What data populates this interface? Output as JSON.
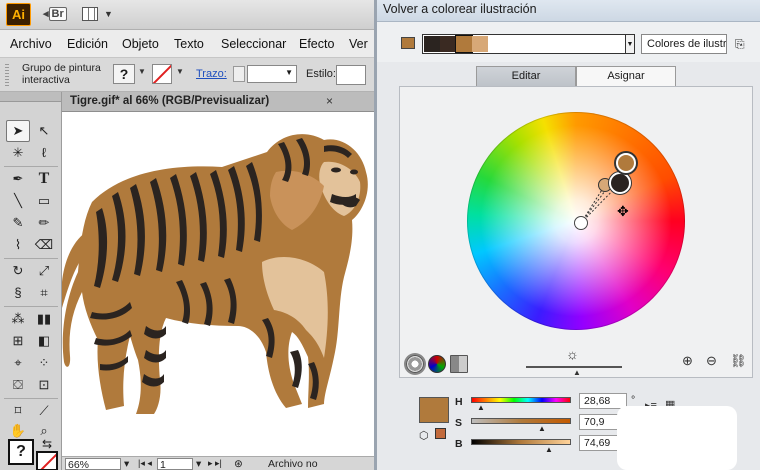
{
  "app": {
    "logo": "Ai",
    "bridge_label": "Br",
    "menu": [
      "Archivo",
      "Edición",
      "Objeto",
      "Texto",
      "Seleccionar",
      "Efecto",
      "Ver"
    ]
  },
  "control_bar": {
    "group_label": "Grupo de pintura interactiva",
    "fill_glyph": "?",
    "stroke_link": "Trazo:",
    "style_label": "Estilo:"
  },
  "document": {
    "tab_title": "Tigre.gif* al 66% (RGB/Previsualizar)",
    "close_glyph": "×",
    "status": {
      "zoom": "66%",
      "page": "1",
      "message": "Archivo no administrad"
    },
    "colors": {
      "tiger_base": "#b07a3c",
      "tiger_light": "#e3c29a",
      "tiger_dark": "#2b2420",
      "tiger_mid": "#c9925a"
    }
  },
  "dialog": {
    "title": "Volver a colorear ilustración",
    "colors_field": "Colores de ilustración",
    "harmony_colors": [
      "#2b2420",
      "#3a2a22",
      "#b07a3c",
      "#d7a877",
      "#ffffff"
    ],
    "tabs": {
      "edit": "Editar",
      "assign": "Asignar"
    },
    "hsb": {
      "H": {
        "label": "H",
        "value": "28,68",
        "unit": "°"
      },
      "S": {
        "label": "S",
        "value": "70,9",
        "unit": "%"
      },
      "B": {
        "label": "B",
        "value": "74,69",
        "unit": "%"
      }
    },
    "active_color": "#b07a3c",
    "secondary_color": "#c26a3c"
  }
}
